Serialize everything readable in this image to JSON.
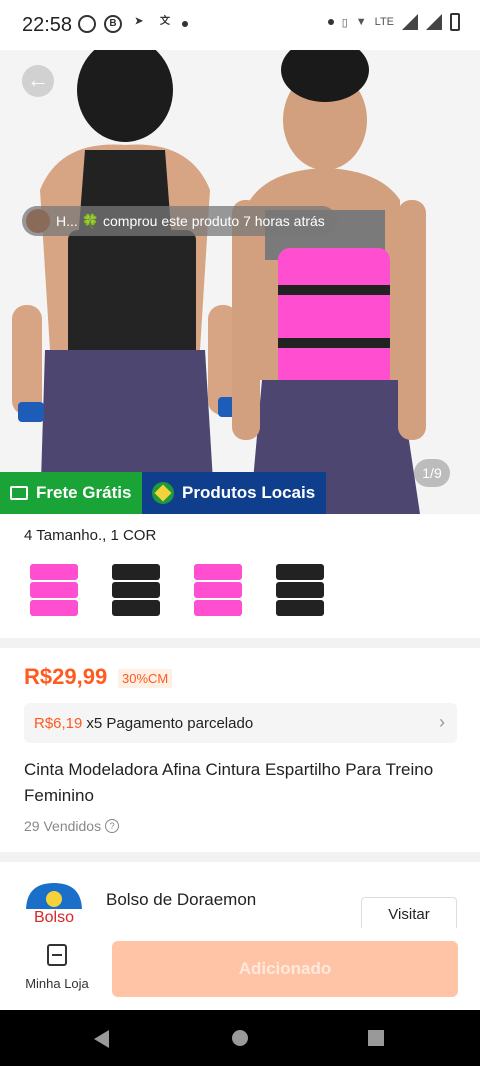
{
  "status_bar": {
    "time": "22:58"
  },
  "hero": {
    "toast": "H... 🍀 comprou este produto 7 horas atrás",
    "pager": "1/9"
  },
  "badges": {
    "free_shipping": "Frete Grátis",
    "local_products": "Produtos Locais"
  },
  "variants": {
    "summary": "4 Tamanho., 1 COR",
    "thumbs": [
      {
        "color": "#ff4fd0"
      },
      {
        "color": "#222222"
      },
      {
        "color": "#ff4fd0"
      },
      {
        "color": "#222222"
      }
    ]
  },
  "price": {
    "current": "R$29,99",
    "discount": "30%CM"
  },
  "installment": {
    "amount": "R$6,19",
    "text": "x5 Pagamento parcelado"
  },
  "product": {
    "title": "Cinta Modeladora Afina Cintura Espartilho Para Treino Feminino",
    "sold": "29 Vendidos"
  },
  "shop": {
    "logo_text": "Bolso",
    "name": "Bolso de Doraemon",
    "visit_label": "Visitar"
  },
  "bottom": {
    "store_label": "Minha Loja",
    "add_label": "Adicionado"
  },
  "colors": {
    "accent": "#ff5a1f",
    "free_shipping_bg": "#1aa336",
    "local_bg": "#0f3f8c"
  }
}
